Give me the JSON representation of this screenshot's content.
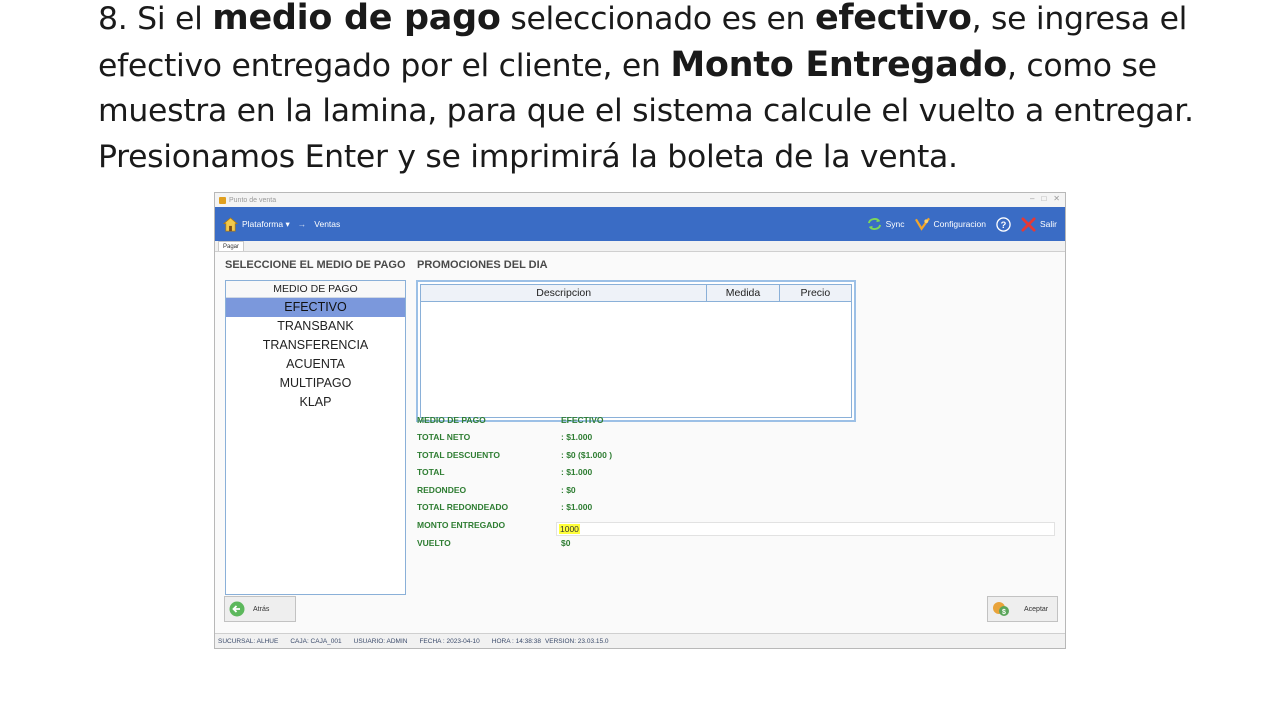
{
  "caption": {
    "p1": "8. Si el ",
    "b1": "medio de pago",
    "p2": " seleccionado es en ",
    "b2": "efectivo",
    "p3": ", se ingresa el efectivo entregado por el cliente, en ",
    "b3": "Monto Entregado",
    "p4": ", como se muestra en la lamina, para que el sistema calcule el vuelto a entregar. Presionamos Enter y se imprimirá la boleta de la venta."
  },
  "window": {
    "title": "Punto de venta"
  },
  "toolbar": {
    "platform": "Plataforma",
    "platform_caret": "▾",
    "separator": "→",
    "section": "Ventas",
    "sync": "Sync",
    "config": "Configuracion",
    "exit": "Salir"
  },
  "tab": {
    "label": "Pagar"
  },
  "payment": {
    "title": "SELECCIONE EL MEDIO DE PAGO",
    "header": "MEDIO DE PAGO",
    "items": [
      "EFECTIVO",
      "TRANSBANK",
      "TRANSFERENCIA",
      "ACUENTA",
      "MULTIPAGO",
      "KLAP"
    ],
    "selected": "EFECTIVO"
  },
  "promo": {
    "title": "PROMOCIONES DEL DIA",
    "columns": [
      "Descripcion",
      "Medida",
      "Precio"
    ]
  },
  "summary": {
    "rows": [
      {
        "label": "MEDIO DE PAGO",
        "value": "EFECTIVO"
      },
      {
        "label": "TOTAL NETO",
        "value": ": $1.000"
      },
      {
        "label": "TOTAL DESCUENTO",
        "value": ": $0 ($1.000 )"
      },
      {
        "label": "TOTAL",
        "value": ": $1.000"
      },
      {
        "label": "REDONDEO",
        "value": ": $0"
      },
      {
        "label": "TOTAL REDONDEADO",
        "value": ": $1.000"
      },
      {
        "label": "MONTO ENTREGADO",
        "value": ""
      },
      {
        "label": "VUELTO",
        "value": "$0"
      }
    ],
    "monto_entregado": "1000"
  },
  "buttons": {
    "back": "Atrás",
    "accept": "Aceptar"
  },
  "status": {
    "sucursal": "SUCURSAL: ALHUE",
    "caja": "CAJA: CAJA_001",
    "usuario": "USUARIO: ADMIN",
    "fecha": "FECHA : 2023-04-10",
    "hora": "HORA : 14:38:38",
    "version": "VERSION: 23.03.15.0"
  },
  "colors": {
    "toolbar": "#3a6cc5",
    "selected": "#7b98dc",
    "summary_text": "#2e7d32",
    "highlight": "#ffff3a"
  }
}
